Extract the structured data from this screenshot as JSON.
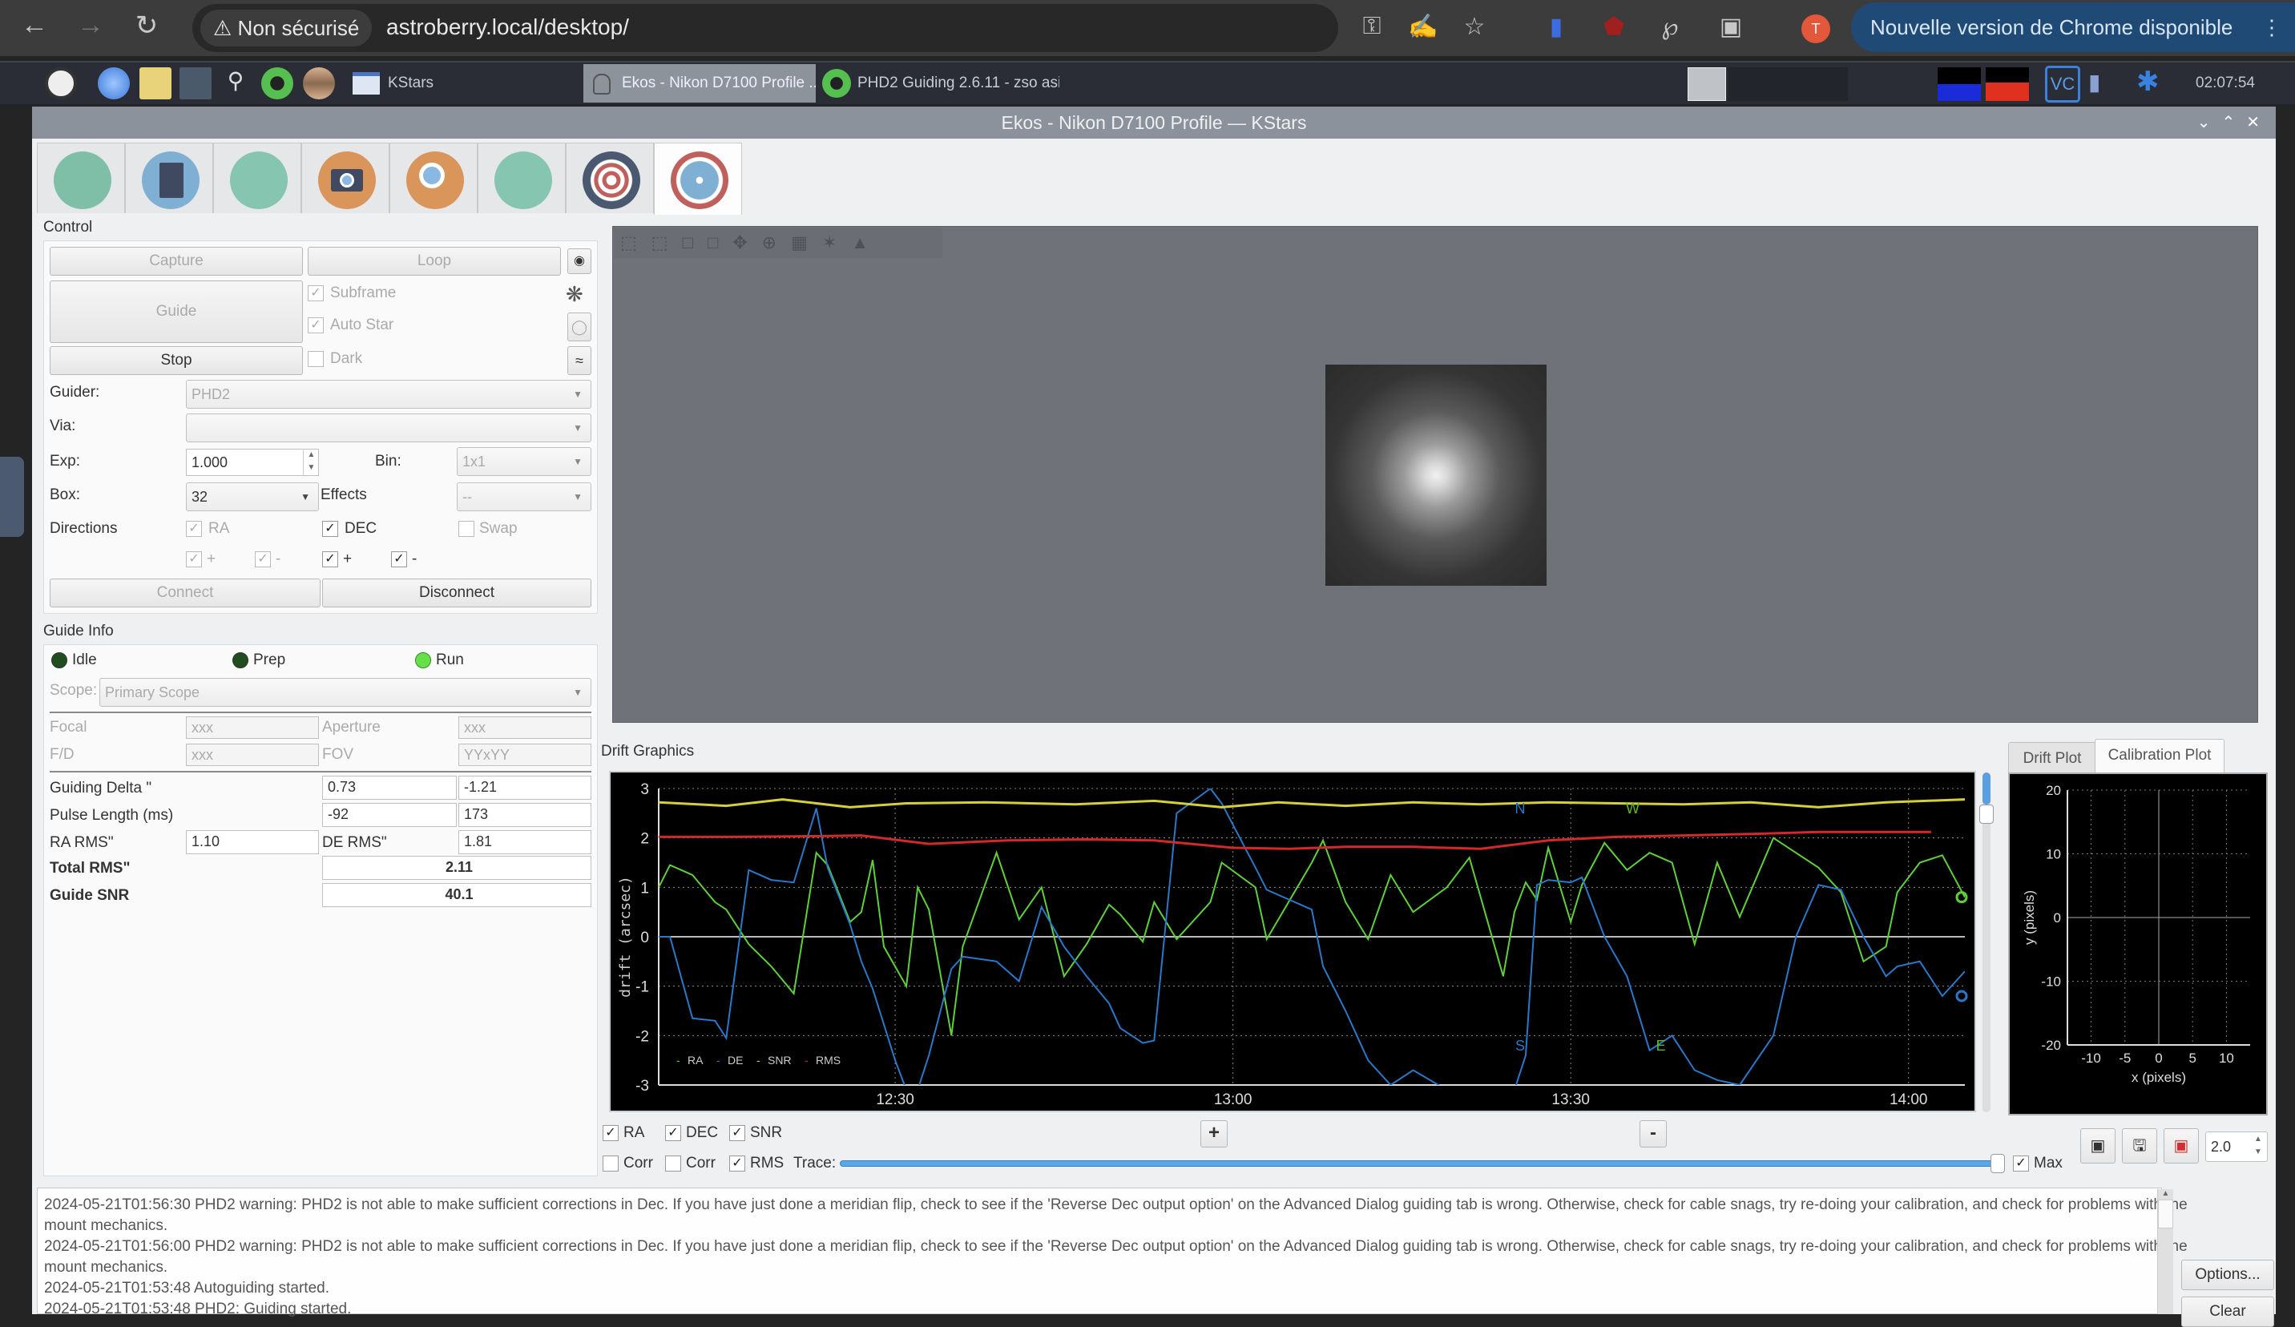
{
  "browser": {
    "security_label": "Non sécurisé",
    "url": "astroberry.local/desktop/",
    "update_label": "Nouvelle version de Chrome disponible",
    "avatar_initial": "T"
  },
  "taskbar": {
    "tasks": [
      {
        "label": "KStars"
      },
      {
        "label": "Ekos - Nikon D7100 Profile ..."
      },
      {
        "label": "PHD2 Guiding 2.6.11 - zso asi"
      }
    ],
    "clock": "02:07:54"
  },
  "window": {
    "title": "Ekos - Nikon D7100 Profile — KStars",
    "controls": "v ^ X"
  },
  "modules": [
    {
      "name": "setup",
      "color": "#7fbfa8"
    },
    {
      "name": "scheduler",
      "color": "#7fb0d4"
    },
    {
      "name": "analyze",
      "color": "#86c6b0"
    },
    {
      "name": "capture",
      "color": "#d9955a"
    },
    {
      "name": "focus",
      "color": "#d9955a"
    },
    {
      "name": "mount",
      "color": "#86c6b0"
    },
    {
      "name": "align",
      "color": "#4a5870"
    },
    {
      "name": "guide",
      "color": "#c0605c",
      "active": true
    }
  ],
  "control": {
    "title": "Control",
    "capture_label": "Capture",
    "loop_label": "Loop",
    "guide_label": "Guide",
    "stop_label": "Stop",
    "subframe_label": "Subframe",
    "subframe_checked": true,
    "autostar_label": "Auto Star",
    "autostar_checked": true,
    "dark_label": "Dark",
    "dark_checked": false,
    "guider_label": "Guider:",
    "guider_value": "PHD2",
    "via_label": "Via:",
    "via_value": "",
    "exp_label": "Exp:",
    "exp_value": "1.000",
    "bin_label": "Bin:",
    "bin_value": "1x1",
    "box_label": "Box:",
    "box_value": "32",
    "effects_label": "Effects",
    "effects_value": "--",
    "directions_label": "Directions",
    "ra_label": "RA",
    "dec_label": "DEC",
    "swap_label": "Swap",
    "plus": "+",
    "minus": "-",
    "connect_label": "Connect",
    "disconnect_label": "Disconnect"
  },
  "guide_info": {
    "title": "Guide Info",
    "states": [
      {
        "label": "Idle",
        "color": "#1f4d1f"
      },
      {
        "label": "Prep",
        "color": "#1f4d1f"
      },
      {
        "label": "Run",
        "color": "#66e04a"
      }
    ],
    "scope_label": "Scope:",
    "scope_value": "Primary Scope",
    "focal_label": "Focal",
    "focal_value": "xxx",
    "aperture_label": "Aperture",
    "aperture_value": "xxx",
    "fd_label": "F/D",
    "fd_value": "xxx",
    "fov_label": "FOV",
    "fov_value": "YYxYY",
    "delta_label": "Guiding Delta \"",
    "delta_ra": "0.73",
    "delta_de": "-1.21",
    "pulse_label": "Pulse Length (ms)",
    "pulse_ra": "-92",
    "pulse_de": "173",
    "ra_rms_label": "RA RMS\"",
    "ra_rms": "1.10",
    "de_rms_label": "DE RMS\"",
    "de_rms": "1.81",
    "total_rms_label": "Total RMS\"",
    "total_rms": "2.11",
    "snr_label": "Guide SNR",
    "snr": "40.1"
  },
  "drift": {
    "title": "Drift Graphics",
    "checks": {
      "ra": {
        "label": "RA",
        "checked": true
      },
      "dec": {
        "label": "DEC",
        "checked": true
      },
      "snr": {
        "label": "SNR",
        "checked": true
      },
      "corr1": {
        "label": "Corr",
        "checked": false
      },
      "corr2": {
        "label": "Corr",
        "checked": false
      },
      "rms": {
        "label": "RMS",
        "checked": true
      },
      "max": {
        "label": "Max",
        "checked": true
      }
    },
    "trace_label": "Trace:",
    "trace_value": 1.0,
    "zoom_in": "+",
    "zoom_out": "-",
    "scale_value": "2.0",
    "tabs": [
      "Drift Plot",
      "Calibration Plot"
    ],
    "active_tab": 1
  },
  "chart_data": [
    {
      "type": "line",
      "title": "Drift Graphics",
      "xlabel": "",
      "ylabel": "drift (arcsec)",
      "ylim": [
        -3,
        3
      ],
      "yticks": [
        3,
        2,
        1,
        0,
        -1,
        -2,
        -3
      ],
      "xticks": [
        {
          "label": "12:30",
          "t": 30
        },
        {
          "label": "13:00",
          "t": 60
        },
        {
          "label": "13:30",
          "t": 90
        },
        {
          "label": "14:00",
          "t": 120
        }
      ],
      "xlim": [
        9,
        125
      ],
      "grid": true,
      "legend": "bottom-left",
      "annotations": [
        {
          "text": "N",
          "t": 85.5,
          "y": 2.5,
          "color": "#2a78c8"
        },
        {
          "text": "W",
          "t": 95.5,
          "y": 2.5,
          "color": "#5fb82a"
        },
        {
          "text": "S",
          "t": 85.5,
          "y": -2.3,
          "color": "#2a78c8"
        },
        {
          "text": "E",
          "t": 98,
          "y": -2.3,
          "color": "#5fb82a"
        }
      ],
      "series": [
        {
          "name": "RA",
          "color": "#5fd03a",
          "t": [
            9,
            10,
            12,
            14,
            15,
            17,
            19,
            21,
            23,
            24,
            26,
            27,
            28,
            29,
            31,
            32,
            33,
            35,
            36,
            39,
            41,
            43,
            45,
            47,
            49,
            50,
            52,
            53,
            55,
            58,
            59,
            62,
            63,
            67,
            68,
            70,
            72,
            74,
            76,
            79,
            81,
            84,
            85,
            86,
            87,
            88,
            90,
            91,
            93,
            95,
            97,
            99,
            101,
            103,
            105,
            108,
            110,
            112,
            114,
            116,
            118,
            119,
            121,
            123,
            125
          ],
          "values": [
            1.0,
            1.45,
            1.25,
            0.7,
            0.55,
            -0.15,
            -0.6,
            -1.15,
            1.7,
            1.45,
            0.3,
            0.5,
            1.55,
            -0.2,
            -1.0,
            1.0,
            0.55,
            -2.0,
            -0.2,
            1.7,
            0.35,
            1.0,
            -0.8,
            -0.15,
            0.65,
            0.45,
            -0.1,
            0.7,
            -0.05,
            0.7,
            1.5,
            1.0,
            -0.05,
            1.5,
            1.95,
            0.7,
            -0.05,
            1.25,
            0.5,
            1.0,
            1.6,
            -0.8,
            0.5,
            1.1,
            0.75,
            1.8,
            0.3,
            1.05,
            1.9,
            1.35,
            1.7,
            1.5,
            -0.15,
            1.5,
            0.4,
            2.0,
            1.7,
            1.4,
            0.9,
            -0.5,
            -0.2,
            0.9,
            1.5,
            1.65,
            0.8
          ]
        },
        {
          "name": "DE",
          "color": "#2a78c8",
          "t": [
            9,
            10,
            12,
            14,
            15,
            17,
            19,
            21,
            23,
            24,
            26,
            27,
            28,
            30,
            31,
            32,
            33,
            35,
            36,
            39,
            41,
            43,
            45,
            47,
            49,
            50,
            52,
            53,
            55,
            58,
            59,
            62,
            63,
            67,
            68,
            70,
            72,
            74,
            76,
            79,
            81,
            84,
            85,
            86,
            87,
            88,
            90,
            91,
            93,
            95,
            97,
            99,
            101,
            103,
            105,
            108,
            110,
            112,
            114,
            116,
            118,
            119,
            121,
            123,
            125
          ],
          "values": [
            0.0,
            0.0,
            -1.65,
            -1.7,
            -2.05,
            1.35,
            1.15,
            1.1,
            2.6,
            1.4,
            0.25,
            -0.5,
            -1.05,
            -2.5,
            -3.1,
            -3.1,
            -2.4,
            -0.65,
            -0.4,
            -0.5,
            -0.9,
            0.6,
            -0.2,
            -0.8,
            -1.35,
            -1.85,
            -2.15,
            -2.1,
            2.5,
            3.0,
            2.7,
            1.4,
            0.95,
            0.55,
            -0.6,
            -1.5,
            -2.5,
            -3.0,
            -2.7,
            -3.1,
            -3.1,
            -3.1,
            -3.1,
            -2.4,
            1.05,
            1.15,
            1.1,
            1.2,
            0.0,
            -0.8,
            -2.3,
            -2.0,
            -2.7,
            -2.9,
            -3.0,
            -2.0,
            0.0,
            1.05,
            0.95,
            0.0,
            -0.8,
            -0.6,
            -0.5,
            -1.2,
            -0.7
          ]
        },
        {
          "name": "SNR",
          "color": "#d4d03a",
          "t": [
            9,
            15,
            20,
            26,
            31,
            38,
            46,
            53,
            59,
            64,
            70,
            76,
            82,
            88,
            94,
            100,
            106,
            112,
            118,
            125
          ],
          "values": [
            2.72,
            2.65,
            2.78,
            2.62,
            2.7,
            2.72,
            2.68,
            2.75,
            2.62,
            2.72,
            2.65,
            2.72,
            2.68,
            2.72,
            2.7,
            2.68,
            2.72,
            2.62,
            2.72,
            2.78
          ]
        },
        {
          "name": "RMS",
          "color": "#d02a2a",
          "t": [
            9,
            15,
            21,
            27,
            33,
            40,
            47,
            53,
            60,
            65,
            70,
            76,
            82,
            88,
            94,
            100,
            106,
            112,
            118,
            122
          ],
          "values": [
            2.02,
            2.02,
            2.03,
            2.05,
            1.88,
            1.95,
            1.97,
            1.95,
            1.8,
            1.78,
            1.82,
            1.82,
            1.78,
            1.95,
            2.02,
            2.05,
            2.08,
            2.12,
            2.12,
            2.12
          ]
        }
      ]
    },
    {
      "type": "scatter",
      "title": "Calibration Plot",
      "xlabel": "x (pixels)",
      "ylabel": "y (pixels)",
      "xlim": [
        -13.5,
        13.5
      ],
      "ylim": [
        -20,
        20
      ],
      "xticks": [
        -10,
        -5,
        0,
        5,
        10
      ],
      "yticks": [
        20,
        10,
        0,
        -10,
        -20
      ],
      "grid": true,
      "series": []
    }
  ],
  "log": {
    "lines": [
      "2024-05-21T01:56:30 PHD2 warning: PHD2 is not able to make sufficient corrections in Dec.  If you have just done a meridian flip, check to see if the 'Reverse Dec output option' on the Advanced Dialog guiding tab is wrong.  Otherwise, check for cable snags, try re-doing your calibration, and check for problems with the",
      "mount mechanics.",
      "2024-05-21T01:56:00 PHD2 warning: PHD2 is not able to make sufficient corrections in Dec.  If you have just done a meridian flip, check to see if the 'Reverse Dec output option' on the Advanced Dialog guiding tab is wrong.  Otherwise, check for cable snags, try re-doing your calibration, and check for problems with the",
      "mount mechanics.",
      "2024-05-21T01:53:48 Autoguiding started.",
      "2024-05-21T01:53:48 PHD2: Guiding started."
    ],
    "options_label": "Options...",
    "clear_label": "Clear"
  }
}
